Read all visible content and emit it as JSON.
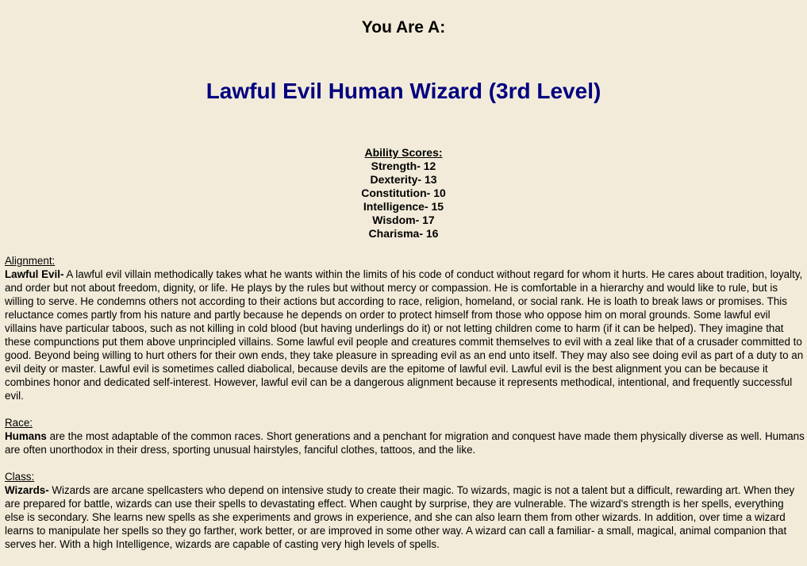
{
  "header": {
    "you_are": "You Are A:",
    "result": "Lawful Evil Human Wizard (3rd Level)"
  },
  "abilities": {
    "title": "Ability Scores:",
    "items": [
      "Strength- 12",
      "Dexterity- 13",
      "Constitution- 10",
      "Intelligence- 15",
      "Wisdom- 17",
      "Charisma- 16"
    ]
  },
  "alignment": {
    "label": "Alignment:",
    "lead": "Lawful Evil-",
    "text": " A lawful evil villain methodically takes what he wants within the limits of his code of conduct without regard for whom it hurts. He cares about tradition, loyalty, and order but not about freedom, dignity, or life. He plays by the rules but without mercy or compassion. He is comfortable in a hierarchy and would like to rule, but is willing to serve. He condemns others not according to their actions but according to race, religion, homeland, or social rank. He is loath to break laws or promises. This reluctance comes partly from his nature and partly because he depends on order to protect himself from those who oppose him on moral grounds. Some lawful evil villains have particular taboos, such as not killing in cold blood (but having underlings do it) or not letting children come to harm (if it can be helped). They imagine that these compunctions put them above unprincipled villains. Some lawful evil people and creatures commit themselves to evil with a zeal like that of a crusader committed to good. Beyond being willing to hurt others for their own ends, they take pleasure in spreading evil as an end unto itself. They may also see doing evil as part of a duty to an evil deity or master. Lawful evil is sometimes called diabolical, because devils are the epitome of lawful evil. Lawful evil is the best alignment you can be because it combines honor and dedicated self-interest. However, lawful evil can be a dangerous alignment because it represents methodical, intentional, and frequently successful evil."
  },
  "race": {
    "label": "Race:",
    "lead": "Humans",
    "text": " are the most adaptable of the common races. Short generations and a penchant for migration and conquest have made them physically diverse as well. Humans are often unorthodox in their dress, sporting unusual hairstyles, fanciful clothes, tattoos, and the like."
  },
  "class": {
    "label": "Class:",
    "lead": "Wizards-",
    "text": " Wizards are arcane spellcasters who depend on intensive study to create their magic. To wizards, magic is not a talent but a difficult, rewarding art. When they are prepared for battle, wizards can use their spells to devastating effect. When caught by surprise, they are vulnerable. The wizard's strength is her spells, everything else is secondary. She learns new spells as she experiments and grows in experience, and she can also learn them from other wizards. In addition, over time a wizard learns to manipulate her spells so they go farther, work better, or are improved in some other way. A wizard can call a familiar- a small, magical, animal companion that serves her. With a high Intelligence, wizards are capable of casting very high levels of spells."
  }
}
